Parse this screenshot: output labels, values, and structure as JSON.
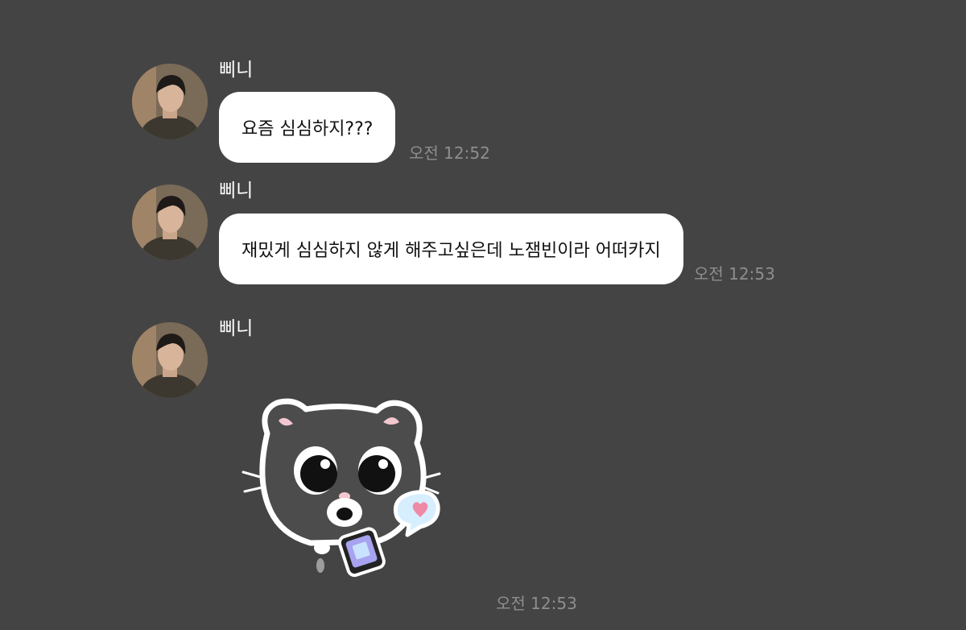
{
  "messages": [
    {
      "sender": "삐니",
      "text": "요즘 심심하지???",
      "time": "오전 12:52"
    },
    {
      "sender": "삐니",
      "text": "재밌게 심심하지 않게 해주고싶은데 노잼빈이라 어떠카지",
      "time": "오전 12:53"
    },
    {
      "sender": "삐니",
      "sticker": "cat-with-phone-sticker",
      "time": "오전 12:53"
    }
  ],
  "colors": {
    "background": "#444444",
    "bubble": "#ffffff",
    "timestamp": "#8e8e8e",
    "sender": "#ffffff"
  }
}
